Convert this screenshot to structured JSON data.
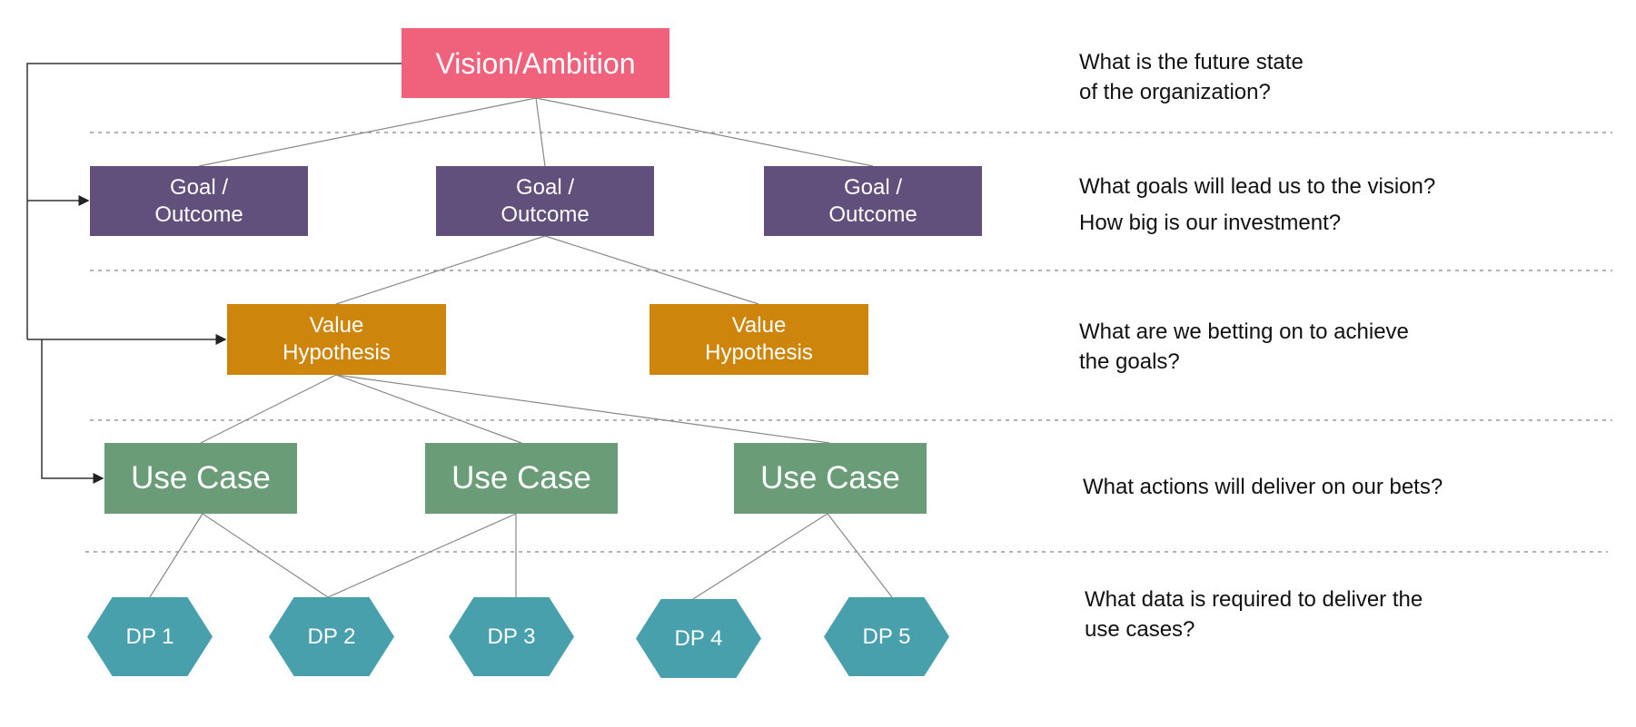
{
  "colors": {
    "vision": "#F0627C",
    "goal": "#614F7C",
    "value_hypothesis": "#CD850C",
    "use_case": "#6A9D77",
    "data_product": "#48A0AD"
  },
  "vision": {
    "label": "Vision/Ambition"
  },
  "goals": [
    {
      "line1": "Goal /",
      "line2": "Outcome"
    },
    {
      "line1": "Goal /",
      "line2": "Outcome"
    },
    {
      "line1": "Goal /",
      "line2": "Outcome"
    }
  ],
  "value_hypotheses": [
    {
      "line1": "Value",
      "line2": "Hypothesis"
    },
    {
      "line1": "Value",
      "line2": "Hypothesis"
    }
  ],
  "use_cases": [
    {
      "label": "Use Case"
    },
    {
      "label": "Use Case"
    },
    {
      "label": "Use Case"
    }
  ],
  "data_products": [
    {
      "label": "DP 1"
    },
    {
      "label": "DP 2"
    },
    {
      "label": "DP 3"
    },
    {
      "label": "DP 4"
    },
    {
      "label": "DP 5"
    }
  ],
  "questions": {
    "vision": [
      "What is the future state",
      "of the organization?"
    ],
    "goals": [
      "What goals will lead us to the vision?",
      "How big is our investment?"
    ],
    "value_hypotheses": [
      "What are we betting on to achieve",
      "the goals?"
    ],
    "use_cases": [
      "What actions will deliver on our bets?"
    ],
    "data_products": [
      "What data is required to deliver the",
      "use cases?"
    ]
  }
}
